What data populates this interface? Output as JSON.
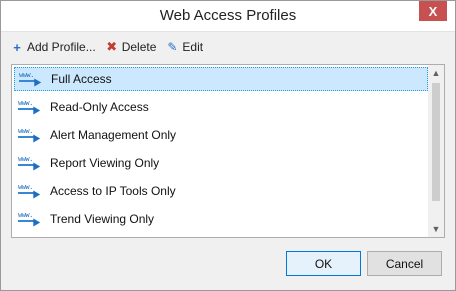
{
  "window": {
    "title": "Web Access Profiles",
    "close_glyph": "X"
  },
  "toolbar": {
    "add_label": "Add Profile...",
    "delete_label": "Delete",
    "edit_label": "Edit"
  },
  "profiles": [
    {
      "label": "Full Access",
      "selected": true
    },
    {
      "label": "Read-Only Access",
      "selected": false
    },
    {
      "label": "Alert Management Only",
      "selected": false
    },
    {
      "label": "Report Viewing Only",
      "selected": false
    },
    {
      "label": "Access to IP Tools Only",
      "selected": false
    },
    {
      "label": "Trend Viewing Only",
      "selected": false
    }
  ],
  "icon_text": "www.",
  "buttons": {
    "ok_label": "OK",
    "cancel_label": "Cancel"
  },
  "colors": {
    "selection": "#cce8ff",
    "close": "#c75050",
    "accent": "#0078d7"
  }
}
